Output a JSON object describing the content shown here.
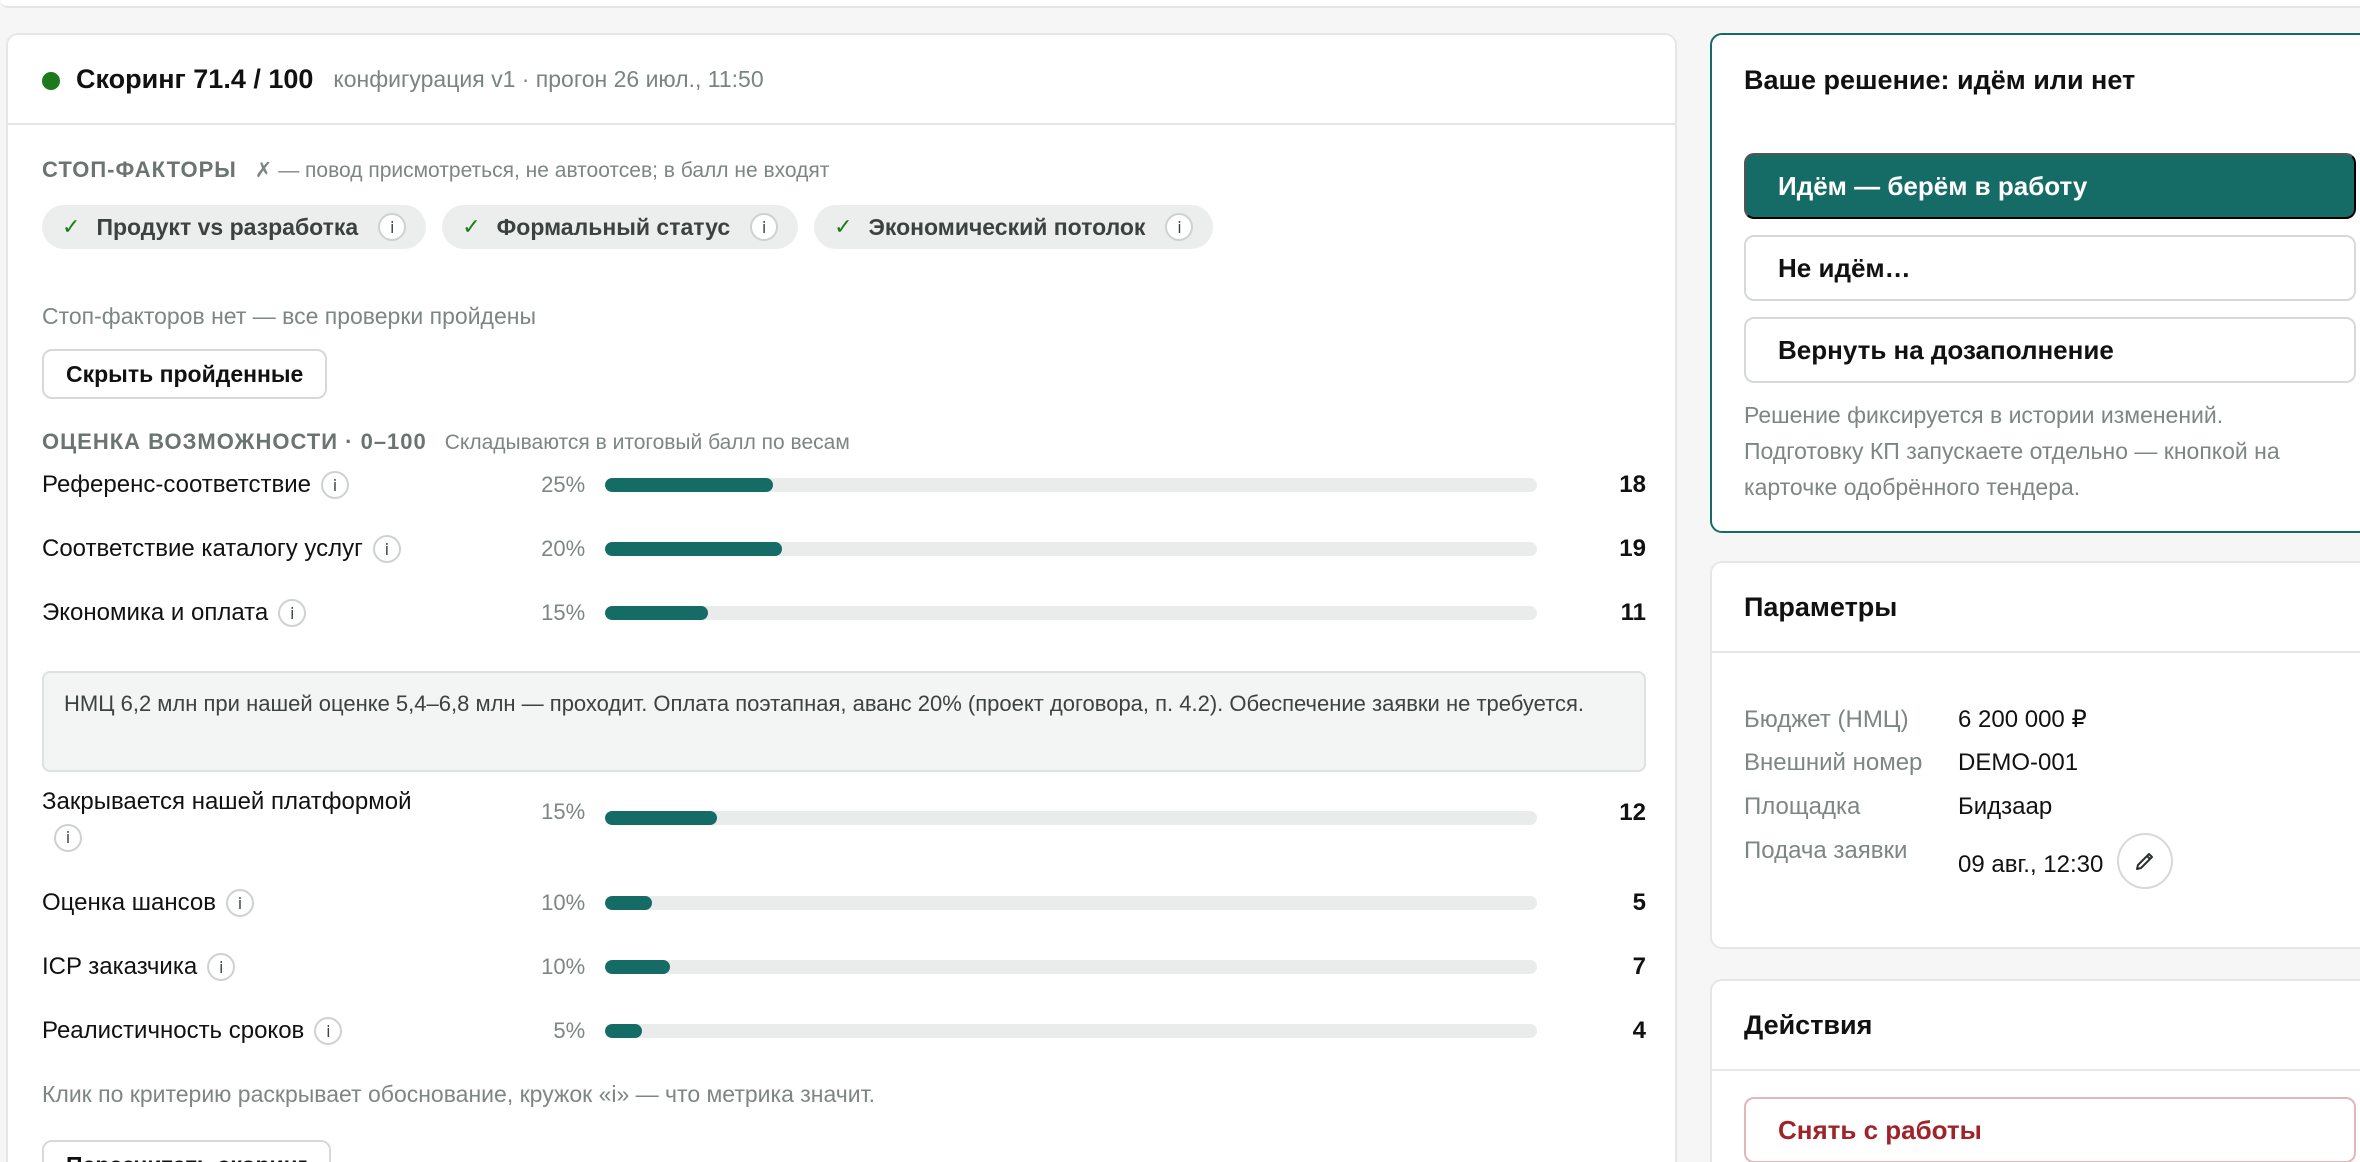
{
  "scoring": {
    "title": "Скоринг 71.4 / 100",
    "meta": "конфигурация v1 · прогон 26 июл., 11:50",
    "status_color": "#1c7a1c"
  },
  "stop_factors": {
    "title": "СТОП-ФАКТОРЫ",
    "hint": "✗ — повод присмотреться, не автоотсев; в балл не входят",
    "chips": [
      {
        "label": "Продукт vs разработка",
        "check": "✓",
        "info": "i"
      },
      {
        "label": "Формальный статус",
        "check": "✓",
        "info": "i"
      },
      {
        "label": "Экономический потолок",
        "check": "✓",
        "info": "i"
      }
    ],
    "note": "Стоп-факторов нет — все проверки пройдены",
    "hide_button": "Скрыть пройденные"
  },
  "opportunity": {
    "title": "ОЦЕНКА ВОЗМОЖНОСТИ · 0–100",
    "hint": "Складываются в итоговый балл по весам",
    "criteria": [
      {
        "name": "Референс-соответствие",
        "weight": "25%",
        "score": "18",
        "fill": 0.18,
        "info": "i"
      },
      {
        "name": "Соответствие каталогу услуг",
        "weight": "20%",
        "score": "19",
        "fill": 0.19,
        "info": "i"
      },
      {
        "name": "Экономика и оплата",
        "weight": "15%",
        "score": "11",
        "fill": 0.11,
        "info": "i"
      },
      {
        "name": "Закрывается нашей платформой",
        "weight": "15%",
        "score": "12",
        "fill": 0.12,
        "info": "i"
      },
      {
        "name": "Оценка шансов",
        "weight": "10%",
        "score": "5",
        "fill": 0.05,
        "info": "i"
      },
      {
        "name": "ICP заказчика",
        "weight": "10%",
        "score": "7",
        "fill": 0.07,
        "info": "i"
      },
      {
        "name": "Реалистичность сроков",
        "weight": "5%",
        "score": "4",
        "fill": 0.04,
        "info": "i"
      }
    ],
    "explanation": "НМЦ 6,2 млн при нашей оценке 5,4–6,8 млн — проходит. Оплата поэтапная, аванс 20% (проект договора, п. 4.2). Обеспечение заявки не требуется.",
    "footer_hint": "Клик по критерию раскрывает обоснование, кружок «i» — что метрика значит.",
    "recalc_button": "Пересчитать скоринг"
  },
  "decision": {
    "title": "Ваше решение: идём или нет",
    "go_button": "Идём — берём в работу",
    "no_button": "Не идём…",
    "return_button": "Вернуть на дозаполнение",
    "note": "Решение фиксируется в истории изменений. Подготовку КП запускаете отдельно — кнопкой на карточке одобрённого тендера."
  },
  "params": {
    "title": "Параметры",
    "rows": [
      {
        "key": "Бюджет (НМЦ)",
        "value": "6 200 000 ₽"
      },
      {
        "key": "Внешний номер",
        "value": "DEMO-001"
      },
      {
        "key": "Площадка",
        "value": "Бидзаар"
      },
      {
        "key": "Подача заявки",
        "value": "09 авг., 12:30"
      }
    ]
  },
  "actions": {
    "title": "Действия",
    "remove_button": "Снять с работы"
  },
  "colors": {
    "accent": "#156b65",
    "danger": "#a1232a",
    "success": "#1c7a1c"
  }
}
